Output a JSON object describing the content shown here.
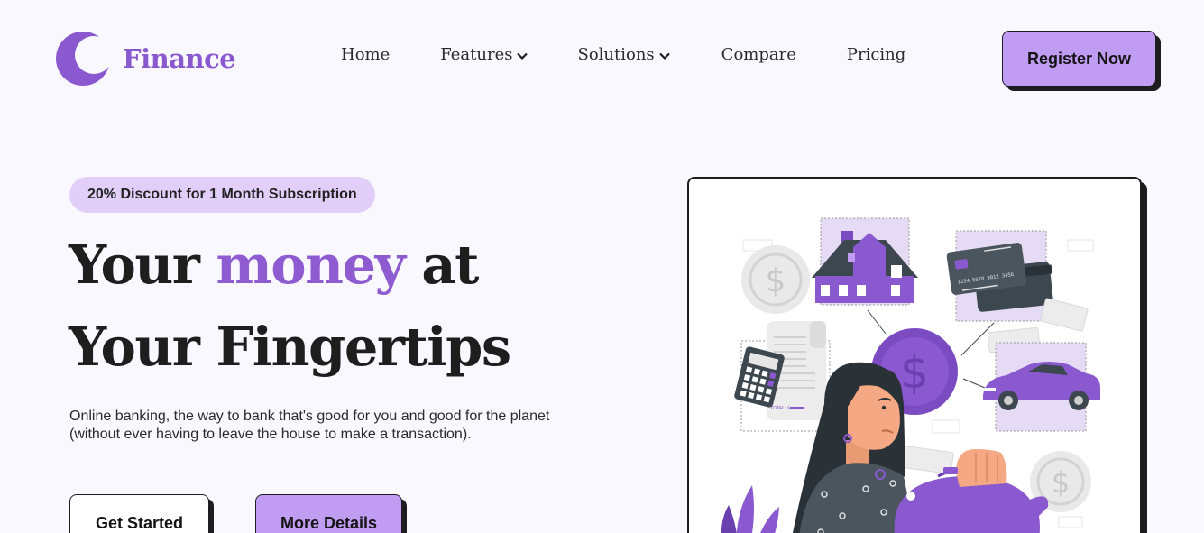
{
  "brand": {
    "name": "Finance",
    "color": "#8a58cf"
  },
  "nav": {
    "items": [
      {
        "label": "Home",
        "dropdown": false
      },
      {
        "label": "Features",
        "dropdown": true
      },
      {
        "label": "Solutions",
        "dropdown": true
      },
      {
        "label": "Compare",
        "dropdown": false
      },
      {
        "label": "Pricing",
        "dropdown": false
      }
    ],
    "register_label": "Register Now"
  },
  "hero": {
    "badge": "20% Discount for 1 Month Subscription",
    "headline": {
      "line1_pre": "Your ",
      "line1_accent": "money",
      "line1_post": " at",
      "line2": "Your Fingertips"
    },
    "description": "Online banking, the way to bank that's good for you and good for the planet (without ever having to leave the house to make a transaction).",
    "primary_button": "Get Started",
    "secondary_button": "More Details"
  },
  "illustration": {
    "icons": [
      "dollar-coin-icon",
      "house-icon",
      "credit-card-icon",
      "car-icon",
      "calculator-icon",
      "receipt-icon",
      "piggy-bank-icon",
      "woman-figure"
    ],
    "card_number": "1234 5678 9012 3456",
    "receipt_total": "TOTAL: $"
  },
  "colors": {
    "accent": "#8f5bd1",
    "button_purple": "#c19cf3",
    "badge_bg": "#e1cff9",
    "page_bg": "#f9f8fe"
  }
}
